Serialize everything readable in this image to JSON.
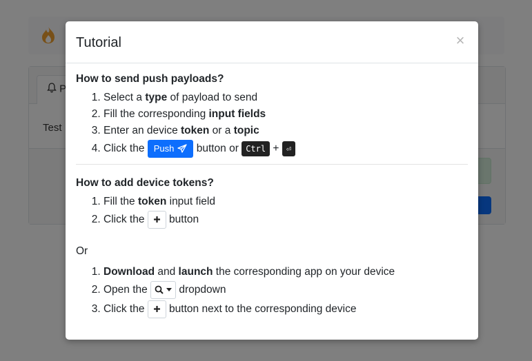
{
  "background": {
    "tab_label": "P",
    "card_text": "Test"
  },
  "modal": {
    "title": "Tutorial",
    "close_glyph": "×",
    "section1": {
      "heading": "How to send push payloads?",
      "steps": [
        {
          "pre": "Select a ",
          "bold": "type",
          "post": " of payload to send"
        },
        {
          "pre": "Fill the corresponding ",
          "bold": "input fields",
          "post": ""
        },
        {
          "pre": "Enter an device ",
          "bold": "token",
          "mid": " or a ",
          "bold2": "topic"
        },
        {
          "pre": "Click the ",
          "button_label": "Push",
          "mid": " button or ",
          "kbd": "Ctrl",
          "plus": " + ",
          "enter_glyph": "⏎"
        }
      ]
    },
    "section2": {
      "heading": "How to add device tokens?",
      "steps": [
        {
          "pre": "Fill the ",
          "bold": "token",
          "post": " input field"
        },
        {
          "pre": "Click the ",
          "post": " button"
        }
      ],
      "or_text": "Or",
      "alt_steps": [
        {
          "bold": "Download",
          "mid": " and ",
          "bold2": "launch",
          "post": " the corresponding app on your device"
        },
        {
          "pre": "Open the ",
          "post": " dropdown"
        },
        {
          "pre": "Click the ",
          "post": " button next to the corresponding device"
        }
      ]
    },
    "icons": {
      "push": "paper-plane-icon",
      "plus": "plus-icon",
      "search": "search-icon",
      "caret": "caret-down-icon",
      "bell": "bell-icon",
      "fire": "fire-icon"
    },
    "colors": {
      "primary": "#0d6efd",
      "kbd_bg": "#222222",
      "logo": "#f0a030"
    }
  }
}
